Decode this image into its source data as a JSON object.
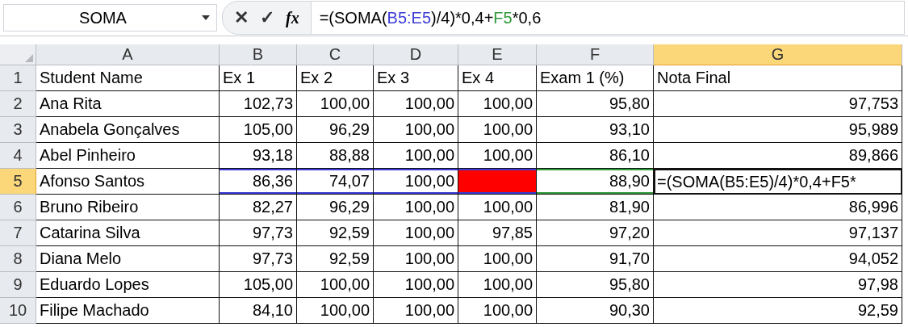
{
  "formula_bar": {
    "name_box": "SOMA",
    "cancel": "✕",
    "enter": "✓",
    "fx": "fx",
    "formula": [
      {
        "text": "=(SOMA(",
        "color": "#000000"
      },
      {
        "text": "B5:E5",
        "color": "#3b3bd6"
      },
      {
        "text": ")/4)*0,4+",
        "color": "#000000"
      },
      {
        "text": "F5",
        "color": "#2e9a3a"
      },
      {
        "text": "*0,6",
        "color": "#000000"
      }
    ]
  },
  "columns": [
    {
      "label": "A",
      "selected": false
    },
    {
      "label": "B",
      "selected": false
    },
    {
      "label": "C",
      "selected": false
    },
    {
      "label": "D",
      "selected": false
    },
    {
      "label": "E",
      "selected": false
    },
    {
      "label": "F",
      "selected": false
    },
    {
      "label": "G",
      "selected": true
    }
  ],
  "rows": [
    {
      "number": "1",
      "selected": false,
      "cells": [
        {
          "text": "Student Name"
        },
        {
          "text": "Ex 1"
        },
        {
          "text": "Ex 2"
        },
        {
          "text": "Ex 3"
        },
        {
          "text": "Ex 4"
        },
        {
          "text": "Exam 1 (%)"
        },
        {
          "text": "Nota Final"
        }
      ]
    },
    {
      "number": "2",
      "selected": false,
      "cells": [
        {
          "text": "Ana Rita"
        },
        {
          "text": "102,73"
        },
        {
          "text": "100,00"
        },
        {
          "text": "100,00"
        },
        {
          "text": "100,00"
        },
        {
          "text": "95,80"
        },
        {
          "text": "97,753"
        }
      ]
    },
    {
      "number": "3",
      "selected": false,
      "cells": [
        {
          "text": "Anabela Gonçalves"
        },
        {
          "text": "105,00"
        },
        {
          "text": "96,29"
        },
        {
          "text": "100,00"
        },
        {
          "text": "100,00"
        },
        {
          "text": "93,10"
        },
        {
          "text": "95,989"
        }
      ]
    },
    {
      "number": "4",
      "selected": false,
      "cells": [
        {
          "text": "Abel Pinheiro"
        },
        {
          "text": "93,18"
        },
        {
          "text": "88,88"
        },
        {
          "text": "100,00"
        },
        {
          "text": "100,00"
        },
        {
          "text": "86,10"
        },
        {
          "text": "89,866"
        }
      ]
    },
    {
      "number": "5",
      "selected": true,
      "cells": [
        {
          "text": "Afonso Santos"
        },
        {
          "text": "86,36",
          "in_range": true
        },
        {
          "text": "74,07",
          "in_range": true
        },
        {
          "text": "100,00",
          "in_range": true
        },
        {
          "in_range": true,
          "color": "#ff0000"
        },
        {
          "text": "88,90",
          "referenced": true
        },
        {
          "text": "=(SOMA(B5:E5)/4)*0,4+F5*",
          "editing": true
        }
      ]
    },
    {
      "number": "6",
      "selected": false,
      "cells": [
        {
          "text": "Bruno Ribeiro"
        },
        {
          "text": "82,27"
        },
        {
          "text": "96,29"
        },
        {
          "text": "100,00"
        },
        {
          "text": "100,00"
        },
        {
          "text": "81,90"
        },
        {
          "text": "86,996"
        }
      ]
    },
    {
      "number": "7",
      "selected": false,
      "cells": [
        {
          "text": "Catarina Silva"
        },
        {
          "text": "97,73"
        },
        {
          "text": "92,59"
        },
        {
          "text": "100,00"
        },
        {
          "text": "97,85"
        },
        {
          "text": "97,20"
        },
        {
          "text": "97,137"
        }
      ]
    },
    {
      "number": "8",
      "selected": false,
      "cells": [
        {
          "text": "Diana Melo"
        },
        {
          "text": "97,73"
        },
        {
          "text": "92,59"
        },
        {
          "text": "100,00"
        },
        {
          "text": "100,00"
        },
        {
          "text": "91,70"
        },
        {
          "text": "94,052"
        }
      ]
    },
    {
      "number": "9",
      "selected": false,
      "cells": [
        {
          "text": "Eduardo Lopes"
        },
        {
          "text": "105,00"
        },
        {
          "text": "100,00"
        },
        {
          "text": "100,00"
        },
        {
          "text": "100,00"
        },
        {
          "text": "95,80"
        },
        {
          "text": "97,98"
        }
      ]
    },
    {
      "number": "10",
      "selected": false,
      "cells": [
        {
          "text": "Filipe Machado"
        },
        {
          "text": "84,10"
        },
        {
          "text": "100,00"
        },
        {
          "text": "100,00"
        },
        {
          "text": "100,00"
        },
        {
          "text": "90,30"
        },
        {
          "text": "92,59"
        }
      ]
    }
  ]
}
